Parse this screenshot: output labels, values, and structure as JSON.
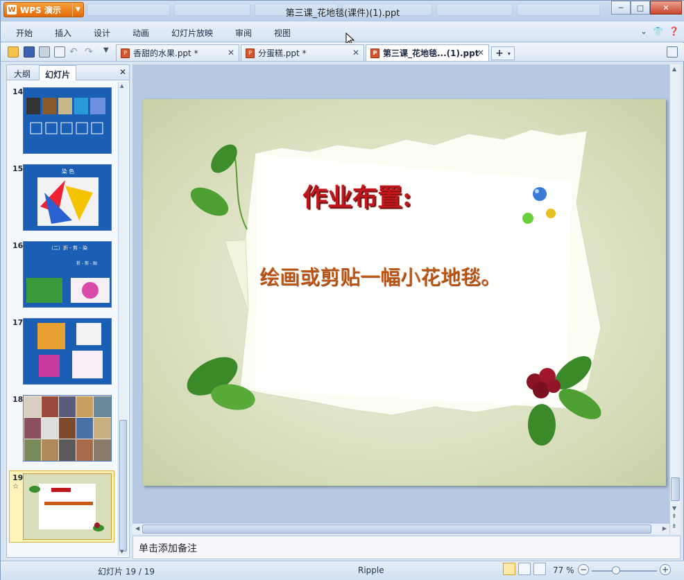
{
  "app": {
    "badge": "WPS 演示",
    "title": "第三课_花地毯(课件)(1).ppt"
  },
  "window_controls": {
    "minimize": "─",
    "maximize": "□",
    "close": "✕"
  },
  "menu": [
    "开始",
    "插入",
    "设计",
    "动画",
    "幻灯片放映",
    "审阅",
    "视图"
  ],
  "doc_tabs": [
    {
      "label": "香甜的水果.ppt *"
    },
    {
      "label": "分蛋糕.ppt *"
    },
    {
      "label": "第三课_花地毯...(1).ppt"
    }
  ],
  "sidebar": {
    "tabs": [
      "大纲",
      "幻灯片"
    ],
    "slides": [
      {
        "num": "14"
      },
      {
        "num": "15",
        "title": "染  色"
      },
      {
        "num": "16",
        "title": "（二）折 - 剪 - 染",
        "caption": "折 - 剪 - 贴"
      },
      {
        "num": "17"
      },
      {
        "num": "18"
      },
      {
        "num": "19"
      }
    ]
  },
  "slide": {
    "title": "作业布置:",
    "body": "绘画或剪贴一幅小花地毯。"
  },
  "notes": {
    "placeholder": "单击添加备注"
  },
  "status": {
    "slide": "幻灯片 19 / 19",
    "theme": "Ripple",
    "zoom": "77 %"
  },
  "colors": {
    "accent": "#e46a07",
    "title_red": "#c0171c",
    "body_orange": "#c85a12"
  }
}
